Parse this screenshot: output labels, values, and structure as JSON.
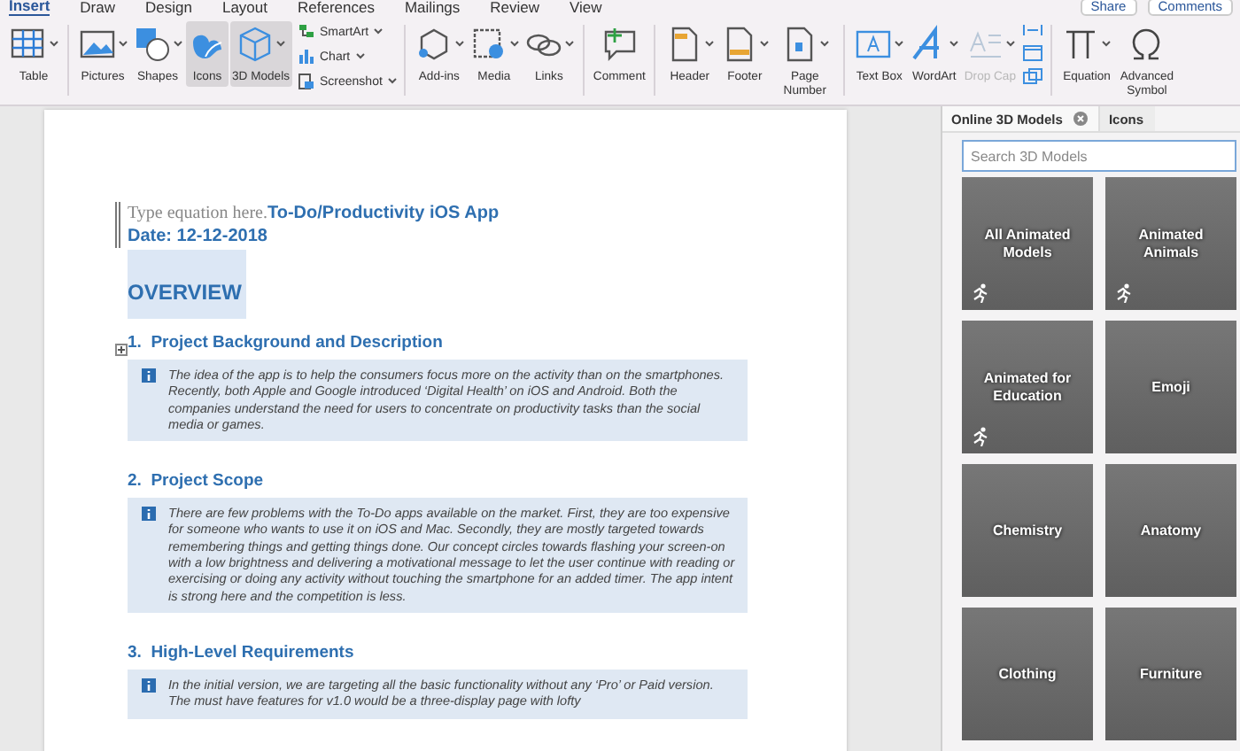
{
  "menu_tabs": [
    {
      "label": "Insert",
      "selected": true
    },
    {
      "label": "Draw",
      "selected": false
    },
    {
      "label": "Design",
      "selected": false
    },
    {
      "label": "Layout",
      "selected": false
    },
    {
      "label": "References",
      "selected": false
    },
    {
      "label": "Mailings",
      "selected": false
    },
    {
      "label": "Review",
      "selected": false
    },
    {
      "label": "View",
      "selected": false
    }
  ],
  "share": "Share",
  "comments": "Comments",
  "ribbon": [
    [
      {
        "kind": "big",
        "label": "Table",
        "dropdown": true,
        "highlighted": false,
        "disabled": false
      }
    ],
    [
      {
        "kind": "big",
        "label": "Pictures",
        "dropdown": true,
        "highlighted": false,
        "disabled": false
      },
      {
        "kind": "big",
        "label": "Shapes",
        "dropdown": true,
        "highlighted": false,
        "disabled": false
      },
      {
        "kind": "big",
        "label": "Icons",
        "dropdown": false,
        "highlighted": true,
        "disabled": false
      },
      {
        "kind": "big",
        "label": "3D Models",
        "dropdown": true,
        "highlighted": true,
        "disabled": false
      },
      {
        "kind": "small",
        "items": [
          {
            "label": "SmartArt"
          },
          {
            "label": "Chart"
          },
          {
            "label": "Screenshot"
          }
        ]
      }
    ],
    [
      {
        "kind": "big",
        "label": "Add-ins",
        "dropdown": true,
        "highlighted": false,
        "disabled": false
      },
      {
        "kind": "big",
        "label": "Media",
        "dropdown": true,
        "highlighted": false,
        "disabled": false
      },
      {
        "kind": "big",
        "label": "Links",
        "dropdown": true,
        "highlighted": false,
        "disabled": false
      }
    ],
    [
      {
        "kind": "big",
        "label": "Comment",
        "dropdown": false,
        "highlighted": false,
        "disabled": false
      }
    ],
    [
      {
        "kind": "big",
        "label": "Header",
        "dropdown": true,
        "highlighted": false,
        "disabled": false
      },
      {
        "kind": "big",
        "label": "Footer",
        "dropdown": true,
        "highlighted": false,
        "disabled": false
      },
      {
        "kind": "big",
        "label": "Page Number",
        "dropdown": true,
        "highlighted": false,
        "disabled": false
      }
    ],
    [
      {
        "kind": "big",
        "label": "Text Box",
        "dropdown": true,
        "highlighted": false,
        "disabled": false
      },
      {
        "kind": "big",
        "label": "WordArt",
        "dropdown": true,
        "highlighted": false,
        "disabled": false
      },
      {
        "kind": "big",
        "label": "Drop Cap",
        "dropdown": true,
        "highlighted": false,
        "disabled": true
      },
      {
        "kind": "icon_stack"
      }
    ],
    [
      {
        "kind": "big",
        "label": "Equation",
        "dropdown": true,
        "highlighted": false,
        "disabled": false
      },
      {
        "kind": "big",
        "label": "Advanced Symbol",
        "dropdown": false,
        "highlighted": false,
        "disabled": false
      }
    ]
  ],
  "document": {
    "equation_placeholder": "Type equation here.",
    "title": "To-Do/Productivity iOS App",
    "date": "Date: 12-12-2018",
    "heading": "OVERVIEW",
    "sections": [
      {
        "number": "1.",
        "title": "Project Background and Description",
        "text": "The idea of the app is to help the consumers focus more on the activity than on the smartphones. Recently, both Apple and Google introduced ‘Digital Health’ on iOS and Android. Both the companies understand the need for users to concentrate on productivity tasks than the social media or games."
      },
      {
        "number": "2.",
        "title": "Project Scope",
        "text": "There are few problems with the To-Do apps available on the market. First, they are too expensive for someone who wants to use it on iOS and Mac. Secondly, they are mostly targeted towards remembering things and getting things done. Our concept circles towards flashing your screen-on with a low brightness and delivering a motivational message to let the user continue with reading or exercising or doing any activity without touching the smartphone for an added timer. The app intent is strong here and the competition is less."
      },
      {
        "number": "3.",
        "title": "High-Level Requirements",
        "text": "In the initial version, we are targeting all the basic functionality without any ‘Pro’ or Paid version. The must have features for v1.0 would be a three-display page with lofty"
      }
    ]
  },
  "pane": {
    "tabs": [
      {
        "label": "Online 3D Models",
        "selected": true,
        "closable": true
      },
      {
        "label": "Icons",
        "selected": false,
        "closable": false
      }
    ],
    "search": {
      "placeholder": "Search 3D Models"
    },
    "tiles": [
      {
        "label": "All Animated Models",
        "animated": true
      },
      {
        "label": "Animated Animals",
        "animated": true
      },
      {
        "label": "Animated for Education",
        "animated": true
      },
      {
        "label": "Emoji",
        "animated": false
      },
      {
        "label": "Chemistry",
        "animated": false
      },
      {
        "label": "Anatomy",
        "animated": false
      },
      {
        "label": "Clothing",
        "animated": false
      },
      {
        "label": "Furniture",
        "animated": false
      }
    ]
  }
}
